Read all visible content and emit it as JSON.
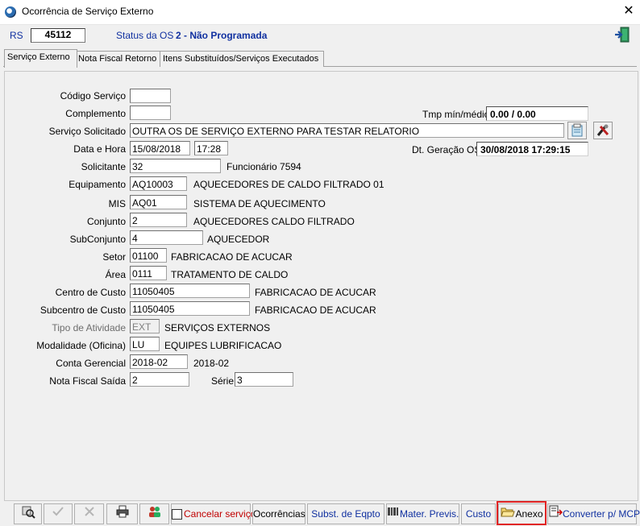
{
  "window": {
    "title": "Ocorrência de Serviço Externo",
    "close_glyph": "✕"
  },
  "header": {
    "rs_label": "RS",
    "rs_value": "45112",
    "status_label": "Status da OS",
    "status_value": "2 - Não Programada",
    "exit_icon": "exit-door-icon"
  },
  "tabs": [
    {
      "label": "Serviço Externo",
      "active": true
    },
    {
      "label": "Nota Fiscal Retorno",
      "active": false
    },
    {
      "label": "Itens Substituídos/Serviços Executados",
      "active": false
    }
  ],
  "form": {
    "codigo_servico": {
      "label": "Código Serviço",
      "value": ""
    },
    "complemento": {
      "label": "Complemento",
      "value": ""
    },
    "tmp": {
      "label": "Tmp mín/médio",
      "value": "0.00 / 0.00"
    },
    "servico_solicitado": {
      "label": "Serviço Solicitado",
      "value": "OUTRA OS DE SERVIÇO EXTERNO PARA TESTAR RELATORIO"
    },
    "data_hora": {
      "label": "Data e Hora",
      "date": "15/08/2018",
      "time": "17:28"
    },
    "dt_geracao": {
      "label": "Dt. Geração OS",
      "value": "30/08/2018 17:29:15"
    },
    "solicitante": {
      "label": "Solicitante",
      "value": "32",
      "desc": "Funcionário 7594"
    },
    "equipamento": {
      "label": "Equipamento",
      "value": "AQ10003",
      "desc": "AQUECEDORES DE CALDO FILTRADO 01"
    },
    "mis": {
      "label": "MIS",
      "value": "AQ01",
      "desc": "SISTEMA DE AQUECIMENTO"
    },
    "conjunto": {
      "label": "Conjunto",
      "value": "2",
      "desc": "AQUECEDORES CALDO FILTRADO"
    },
    "subconjunto": {
      "label": "SubConjunto",
      "value": "4",
      "desc": "AQUECEDOR"
    },
    "setor": {
      "label": "Setor",
      "value": "01100",
      "desc": "FABRICACAO DE ACUCAR"
    },
    "area": {
      "label": "Área",
      "value": "0111",
      "desc": "TRATAMENTO DE CALDO"
    },
    "centro_custo": {
      "label": "Centro de Custo",
      "value": "11050405",
      "desc": "FABRICACAO DE ACUCAR"
    },
    "subcentro_custo": {
      "label": "Subcentro de Custo",
      "value": "11050405",
      "desc": "FABRICACAO DE ACUCAR"
    },
    "tipo_atividade": {
      "label": "Tipo de Atividade",
      "value": "EXT",
      "desc": "SERVIÇOS EXTERNOS"
    },
    "modalidade": {
      "label": "Modalidade (Oficina)",
      "value": "LU",
      "desc": "EQUIPES LUBRIFICACAO"
    },
    "conta_gerencial": {
      "label": "Conta Gerencial",
      "value": "2018-02",
      "desc": "2018-02"
    },
    "nota_fiscal_saida": {
      "label": "Nota Fiscal Saída",
      "value": "2"
    },
    "serie": {
      "label": "Série",
      "value": "3"
    }
  },
  "toolbar": {
    "cancelar": "Cancelar serviço",
    "ocorrencias": "Ocorrências",
    "subst_eqpto": "Subst. de Eqpto",
    "mater_previs": "Mater. Previs.",
    "custo": "Custo",
    "anexo": "Anexo",
    "converter": "Converter p/ MCP"
  },
  "colors": {
    "label_blue": "#1030a0",
    "cancel_red": "#c00000",
    "highlight_red": "#e02424"
  }
}
